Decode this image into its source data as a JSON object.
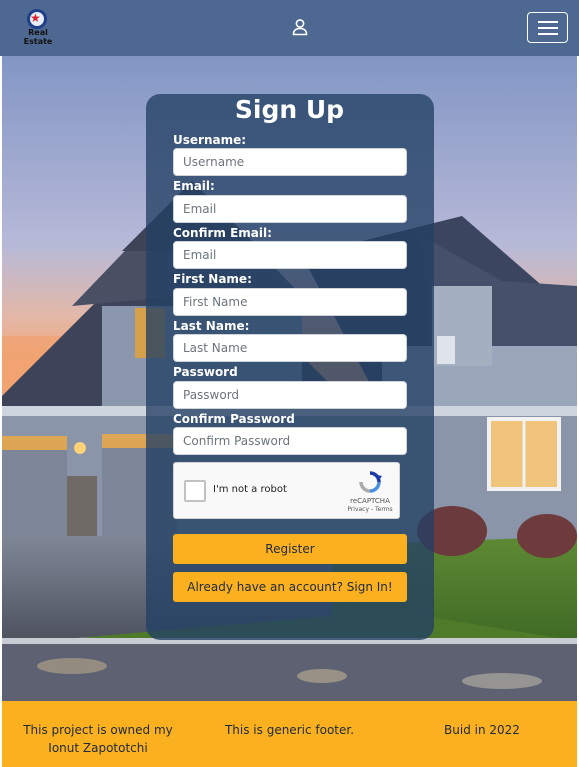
{
  "header": {
    "logo_text_line1": "Real",
    "logo_text_line2": "Estate",
    "user_icon": "user-icon",
    "menu_icon": "hamburger-menu-icon"
  },
  "form": {
    "title": "Sign Up",
    "fields": [
      {
        "label": "Username:",
        "placeholder": "Username"
      },
      {
        "label": "Email:",
        "placeholder": "Email"
      },
      {
        "label": "Confirm Email:",
        "placeholder": "Email"
      },
      {
        "label": "First Name:",
        "placeholder": "First Name"
      },
      {
        "label": "Last Name:",
        "placeholder": "Last Name"
      },
      {
        "label": "Password",
        "placeholder": "Password"
      },
      {
        "label": "Confirm Password",
        "placeholder": "Confirm Password"
      }
    ],
    "captcha": {
      "label": "I'm not a robot",
      "brand": "reCAPTCHA",
      "links": "Privacy - Terms"
    },
    "register_label": "Register",
    "signin_label": "Already have an account? Sign In!"
  },
  "footer": {
    "owner_line1": "This project is owned my",
    "owner_line2": "Ionut Zapototchi",
    "generic": "This is generic footer.",
    "build": "Buid in 2022"
  },
  "colors": {
    "header_bg": "#4d6891",
    "accent": "#fbb01f",
    "panel_bg": "#234064"
  }
}
